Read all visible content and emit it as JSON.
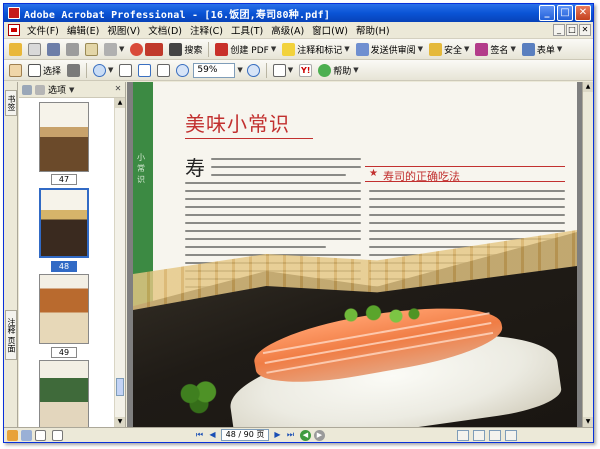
{
  "window": {
    "title": "Adobe Acrobat Professional - [16.饭团,寿司80种.pdf]",
    "controls": {
      "minimize": "_",
      "maximize": "□",
      "close": "✕"
    }
  },
  "menu": {
    "items": [
      "文件(F)",
      "编辑(E)",
      "视图(V)",
      "文档(D)",
      "注释(C)",
      "工具(T)",
      "高级(A)",
      "窗口(W)",
      "帮助(H)"
    ],
    "doc_controls": [
      "_",
      "□",
      "✕"
    ]
  },
  "toolbar1": {
    "search_label": "搜索",
    "create_pdf_label": "创建 PDF",
    "review_comment_label": "注释和标记",
    "send_review_label": "发送供审阅",
    "secure_label": "安全",
    "sign_label": "签名",
    "forms_label": "表单"
  },
  "toolbar2": {
    "select_label": "选择",
    "zoom_value": "59%",
    "help_label": "帮助"
  },
  "nav_panel": {
    "tab_top": "书签",
    "tab_bottom": "注释 页面",
    "options_label": "选项",
    "close": "✕",
    "thumbnails": [
      {
        "label": "47",
        "selected": false
      },
      {
        "label": "48",
        "selected": true
      },
      {
        "label": "49",
        "selected": false
      }
    ]
  },
  "document": {
    "heading": "美味小常识",
    "first_char": "寿",
    "sidebox_title": "寿司的正确吃法",
    "sidebar_vertical_text": "小常识"
  },
  "statusbar": {
    "page_display": "48 / 90 页",
    "first": "⏮",
    "prev": "◀",
    "next": "▶",
    "last": "⏭"
  },
  "colors": {
    "title_blue": "#0a54d6",
    "heading_red": "#c2302f",
    "page_green": "#3c8a43"
  }
}
